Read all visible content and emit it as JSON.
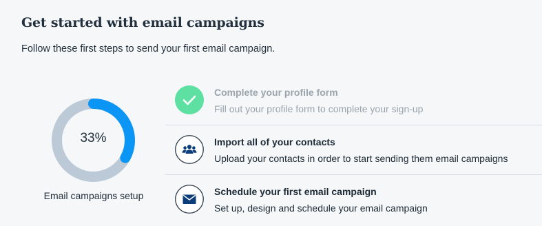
{
  "header": {
    "title": "Get started with email campaigns",
    "subtitle": "Follow these first steps to send your first email campaign."
  },
  "progress": {
    "value_text": "33%",
    "fraction": 0.33,
    "label": "Email campaigns setup",
    "track_color": "#bccad8",
    "fill_color": "#0b96f5"
  },
  "steps": [
    {
      "icon": "check-icon",
      "status": "complete",
      "title": "Complete your profile form",
      "description": "Fill out your profile form to complete your sign-up",
      "color": "#5ee0a3"
    },
    {
      "icon": "contacts-group-icon",
      "status": "pending",
      "title": "Import all of your contacts",
      "description": "Upload your contacts in order to start sending them email campaigns",
      "color": "#0b3d7a"
    },
    {
      "icon": "envelope-icon",
      "status": "pending",
      "title": "Schedule your first email campaign",
      "description": "Set up, design and schedule your email campaign",
      "color": "#0b3d7a"
    }
  ]
}
